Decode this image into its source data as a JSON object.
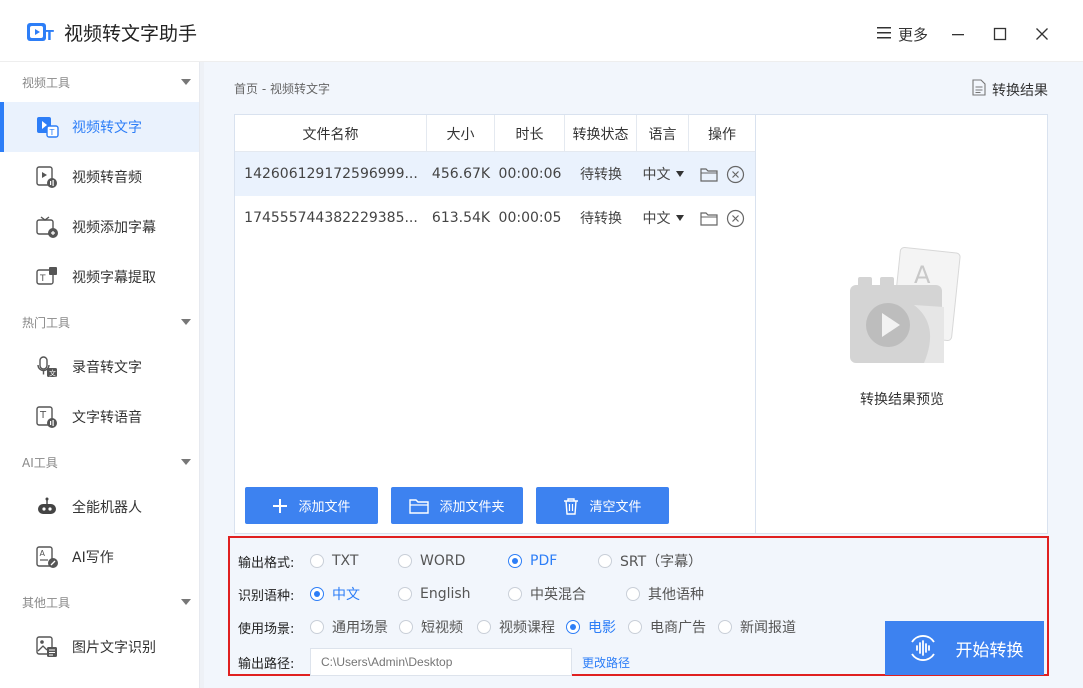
{
  "app": {
    "title": "视频转文字助手",
    "more_label": "更多"
  },
  "sidebar": {
    "sections": [
      {
        "label": "视频工具",
        "items": [
          "视频转文字",
          "视频转音频",
          "视频添加字幕",
          "视频字幕提取"
        ]
      },
      {
        "label": "热门工具",
        "items": [
          "录音转文字",
          "文字转语音"
        ]
      },
      {
        "label": "AI工具",
        "items": [
          "全能机器人",
          "AI写作"
        ]
      },
      {
        "label": "其他工具",
        "items": [
          "图片文字识别"
        ]
      }
    ],
    "active": "视频转文字"
  },
  "main": {
    "breadcrumb": "首页 - 视频转文字",
    "result_link": "转换结果"
  },
  "table": {
    "headers": [
      "文件名称",
      "大小",
      "时长",
      "转换状态",
      "语言",
      "操作"
    ],
    "rows": [
      {
        "name": "142606129172596999...",
        "size": "456.67K",
        "duration": "00:00:06",
        "status": "待转换",
        "lang": "中文"
      },
      {
        "name": "174555744382229385...",
        "size": "613.54K",
        "duration": "00:00:05",
        "status": "待转换",
        "lang": "中文"
      }
    ]
  },
  "buttons": {
    "add_file": "添加文件",
    "add_folder": "添加文件夹",
    "clear": "清空文件"
  },
  "preview": {
    "label": "转换结果预览"
  },
  "options": {
    "format": {
      "label": "输出格式:",
      "choices": [
        "TXT",
        "WORD",
        "PDF",
        "SRT（字幕）"
      ],
      "selected": "PDF"
    },
    "language": {
      "label": "识别语种:",
      "choices": [
        "中文",
        "English",
        "中英混合",
        "其他语种"
      ],
      "selected": "中文"
    },
    "scene": {
      "label": "使用场景:",
      "choices": [
        "通用场景",
        "短视频",
        "视频课程",
        "电影",
        "电商广告",
        "新闻报道"
      ],
      "selected": "电影"
    },
    "path": {
      "label": "输出路径:",
      "placeholder": "C:\\Users\\Admin\\Desktop",
      "change_label": "更改路径"
    }
  },
  "start_button": "开始转换",
  "colors": {
    "accent": "#3d82f0",
    "highlight_border": "#e02020",
    "selected_bg": "#eaf2fd"
  }
}
